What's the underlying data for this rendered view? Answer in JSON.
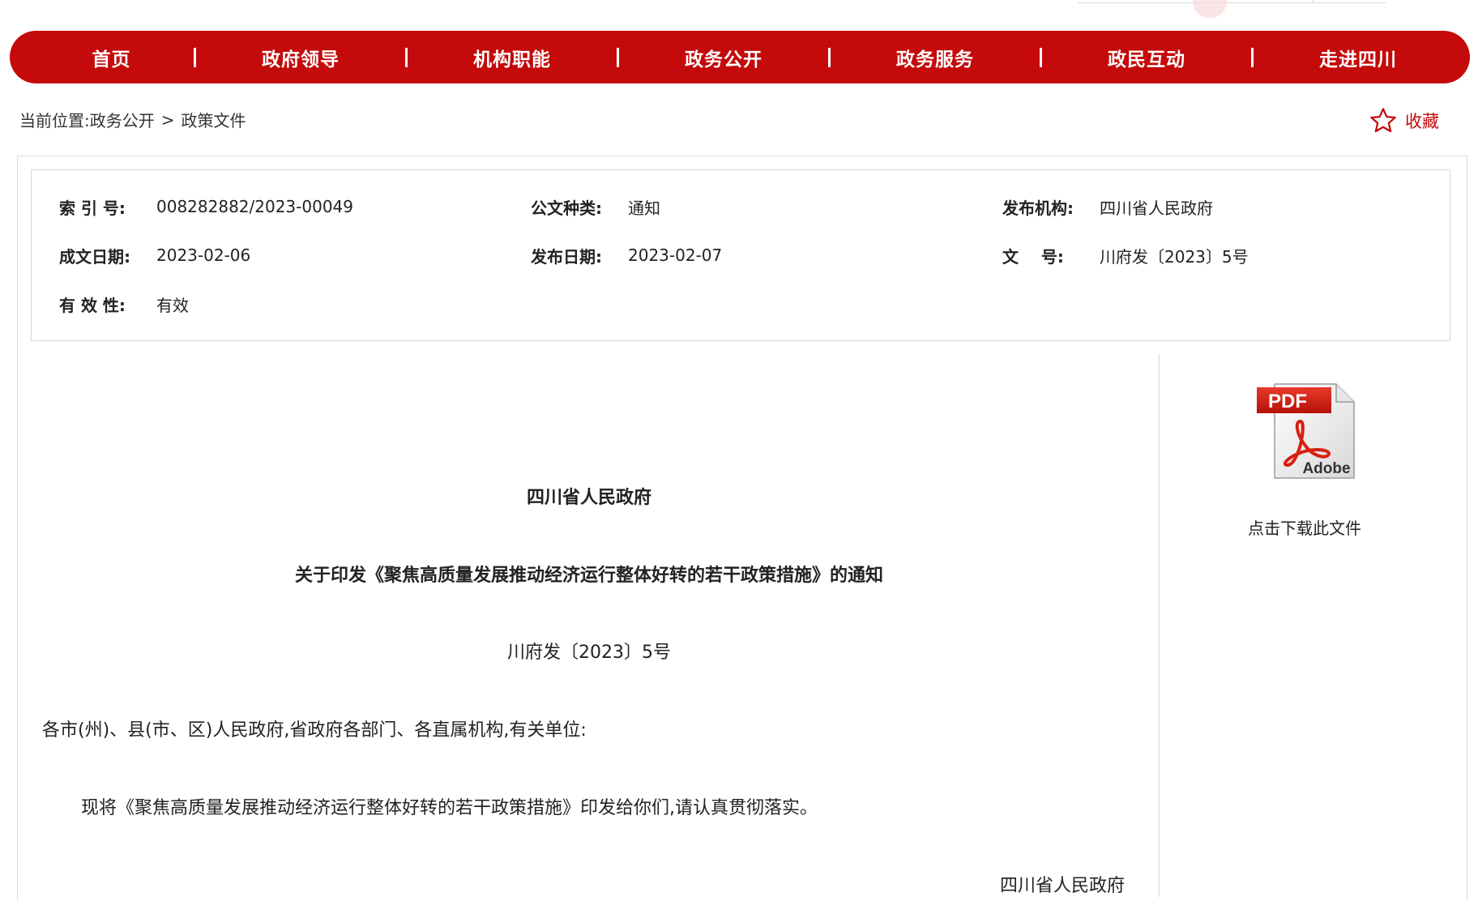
{
  "nav": {
    "items": [
      {
        "label": "首页"
      },
      {
        "label": "政府领导"
      },
      {
        "label": "机构职能"
      },
      {
        "label": "政务公开"
      },
      {
        "label": "政务服务"
      },
      {
        "label": "政民互动"
      },
      {
        "label": "走进四川"
      }
    ],
    "separator": "|"
  },
  "breadcrumb": {
    "prefix": "当前位置:",
    "items": [
      "政务公开",
      "政策文件"
    ],
    "separator": ">"
  },
  "favorite": {
    "label": "收藏",
    "icon": "star-outline-icon"
  },
  "meta": {
    "index_label": "索 引 号:",
    "index_value": "008282882/2023-00049",
    "doc_type_label": "公文种类:",
    "doc_type_value": "通知",
    "publisher_label": "发布机构:",
    "publisher_value": "四川省人民政府",
    "written_date_label": "成文日期:",
    "written_date_value": "2023-02-06",
    "publish_date_label": "发布日期:",
    "publish_date_value": "2023-02-07",
    "doc_no_label": "文    号:",
    "doc_no_value": "川府发〔2023〕5号",
    "validity_label": "有 效 性:",
    "validity_value": "有效"
  },
  "document": {
    "issuer": "四川省人民政府",
    "title": "关于印发《聚焦高质量发展推动经济运行整体好转的若干政策措施》的通知",
    "number": "川府发〔2023〕5号",
    "addressee": "各市(州)、县(市、区)人民政府,省政府各部门、各直属机构,有关单位:",
    "body": "现将《聚焦高质量发展推动经济运行整体好转的若干政策措施》印发给你们,请认真贯彻落实。",
    "signature": "四川省人民政府"
  },
  "download": {
    "label": "点击下载此文件",
    "icon": "pdf-adobe-icon",
    "icon_text_top": "PDF",
    "icon_text_bottom": "Adobe"
  },
  "colors": {
    "brand_red": "#c40a0a",
    "border": "#d6d6d6"
  }
}
